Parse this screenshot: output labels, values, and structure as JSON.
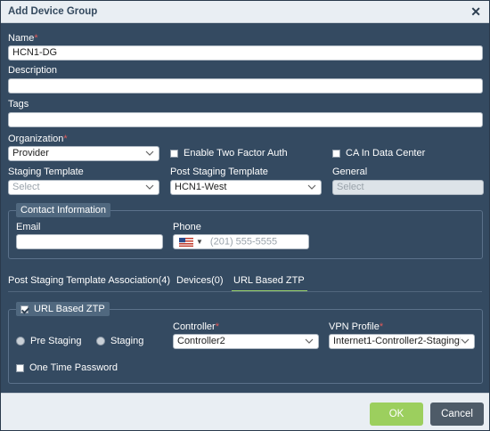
{
  "dialog": {
    "title": "Add Device Group",
    "close_icon": "close-icon"
  },
  "form": {
    "name_label": "Name",
    "required_mark": "*",
    "name_value": "HCN1-DG",
    "description_label": "Description",
    "description_value": "",
    "tags_label": "Tags",
    "tags_value": "",
    "organization_label": "Organization",
    "organization_value": "Provider",
    "two_factor_label": "Enable Two Factor Auth",
    "two_factor_checked": false,
    "ca_label": "CA In Data Center",
    "ca_checked": false,
    "staging_template_label": "Staging Template",
    "staging_template_value": "Select",
    "post_staging_template_label": "Post Staging Template",
    "post_staging_template_value": "HCN1-West",
    "general_label": "General",
    "general_value": "Select"
  },
  "contact": {
    "legend": "Contact Information",
    "email_label": "Email",
    "email_value": "",
    "phone_label": "Phone",
    "phone_placeholder": "(201) 555-5555",
    "country_flag": "us-flag-icon"
  },
  "tabs": [
    {
      "label": "Post Staging Template Association(4)",
      "active": false
    },
    {
      "label": "Devices(0)",
      "active": false
    },
    {
      "label": "URL Based ZTP",
      "active": true
    }
  ],
  "ztp": {
    "legend": "URL Based ZTP",
    "legend_checked": true,
    "pre_staging_label": "Pre Staging",
    "staging_label": "Staging",
    "controller_label": "Controller",
    "controller_value": "Controller2",
    "vpn_profile_label": "VPN Profile",
    "vpn_profile_value": "Internet1-Controller2-StagingI",
    "otp_label": "One Time Password",
    "otp_checked": false
  },
  "footer": {
    "ok_label": "OK",
    "cancel_label": "Cancel"
  },
  "colors": {
    "body_bg": "#344a61",
    "ok_green": "#9ccf5e",
    "tab_active_underline": "#9bd36a",
    "required_red": "#e05a5a"
  }
}
